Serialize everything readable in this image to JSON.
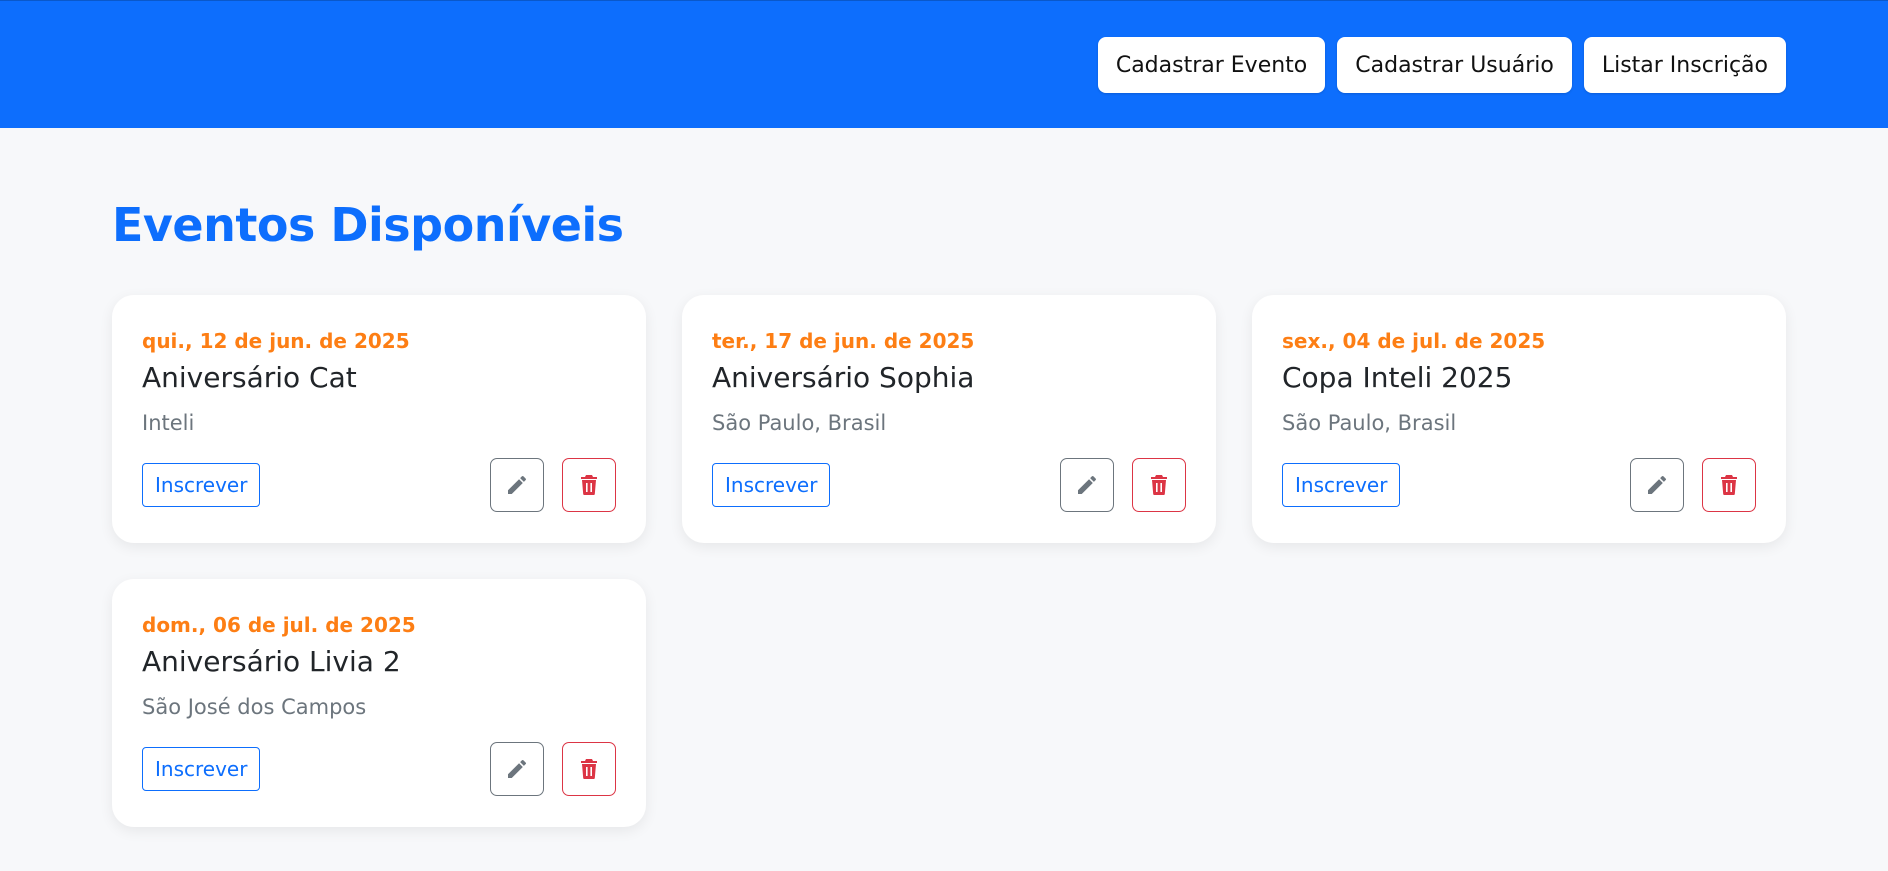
{
  "nav": {
    "items": [
      {
        "label": "Cadastrar Evento"
      },
      {
        "label": "Cadastrar Usuário"
      },
      {
        "label": "Listar Inscrição"
      }
    ]
  },
  "main": {
    "title": "Eventos Disponíveis",
    "subscribe_label": "Inscrever",
    "events": [
      {
        "date": "qui., 12 de jun. de 2025",
        "name": "Aniversário Cat",
        "location": "Inteli"
      },
      {
        "date": "ter., 17 de jun. de 2025",
        "name": "Aniversário Sophia",
        "location": "São Paulo, Brasil"
      },
      {
        "date": "sex., 04 de jul. de 2025",
        "name": "Copa Inteli 2025",
        "location": "São Paulo, Brasil"
      },
      {
        "date": "dom., 06 de jul. de 2025",
        "name": "Aniversário Livia 2",
        "location": "São José dos Campos"
      }
    ]
  },
  "icons": {
    "edit": "pencil-icon",
    "delete": "trash-icon"
  },
  "colors": {
    "primary": "#0d6efd",
    "date_accent": "#fd7e14",
    "edit_icon": "#6c757d",
    "delete_icon": "#dc3545",
    "page_background": "#f7f8fa"
  }
}
